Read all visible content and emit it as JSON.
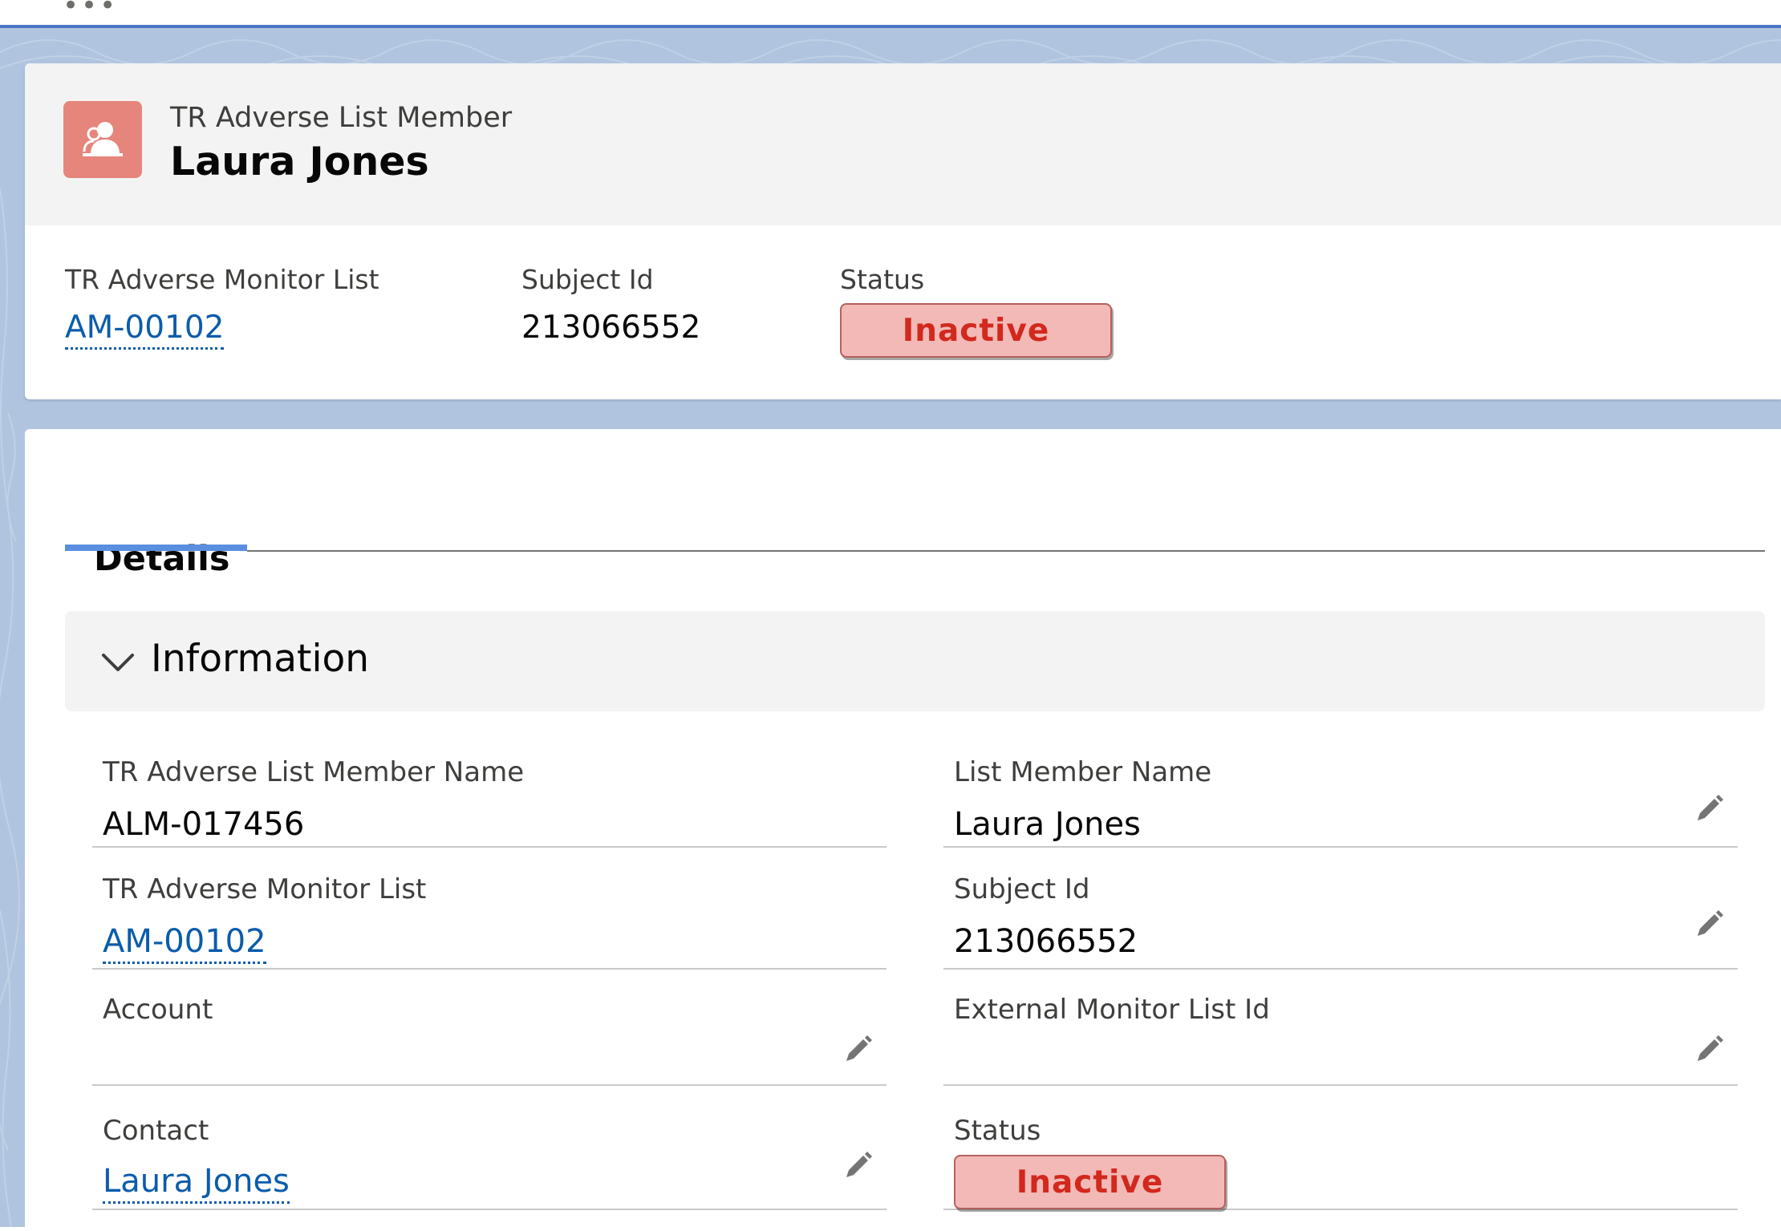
{
  "header": {
    "object_label": "TR Adverse List Member",
    "record_name": "Laura Jones",
    "highlights": {
      "monitor_list_label": "TR Adverse Monitor List",
      "monitor_list_value": "AM-00102",
      "subject_id_label": "Subject Id",
      "subject_id_value": "213066552",
      "status_label": "Status",
      "status_value": "Inactive"
    }
  },
  "tabs": {
    "details_label": "Details"
  },
  "section": {
    "title": "Information"
  },
  "fields": {
    "member_name_label": "TR Adverse List Member Name",
    "member_name_value": "ALM-017456",
    "list_member_name_label": "List Member Name",
    "list_member_name_value": "Laura Jones",
    "monitor_list_label": "TR Adverse Monitor List",
    "monitor_list_value": "AM-00102",
    "subject_id_label": "Subject Id",
    "subject_id_value": "213066552",
    "account_label": "Account",
    "account_value": "",
    "external_id_label": "External Monitor List Id",
    "external_id_value": "",
    "contact_label": "Contact",
    "contact_value": "Laura Jones",
    "status_label": "Status",
    "status_value": "Inactive"
  },
  "colors": {
    "accent": "#5a8ee0",
    "link": "#0b5cab",
    "icon_bg": "#e5857b",
    "status_bg": "#f3b9b6",
    "status_text": "#d2281d"
  },
  "icons": {
    "record": "user-group-icon",
    "chevron": "chevron-down-icon",
    "edit": "pencil-icon"
  }
}
